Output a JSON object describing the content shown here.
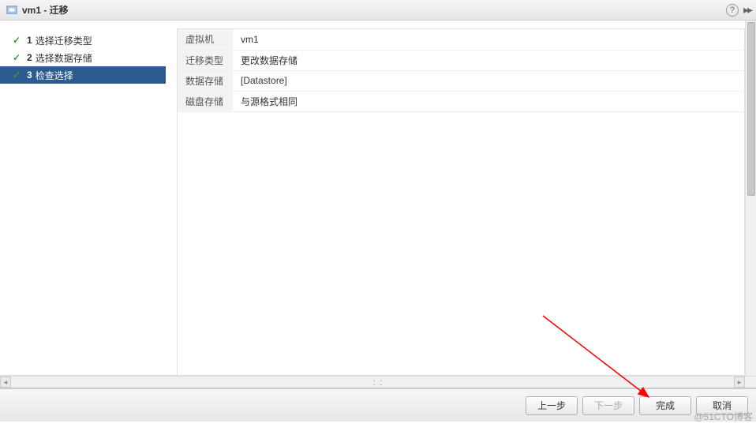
{
  "titlebar": {
    "title": "vm1 - 迁移"
  },
  "sidebar": {
    "steps": [
      {
        "num": "1",
        "label": "选择迁移类型",
        "status": "completed"
      },
      {
        "num": "2",
        "label": "选择数据存储",
        "status": "completed"
      },
      {
        "num": "3",
        "label": "检查选择",
        "status": "current"
      }
    ]
  },
  "summary": {
    "rows": [
      {
        "label": "虚拟机",
        "value": "vm1"
      },
      {
        "label": "迁移类型",
        "value": "更改数据存储"
      },
      {
        "label": "数据存储",
        "value": "[Datastore]"
      },
      {
        "label": "磁盘存储",
        "value": "与源格式相同"
      }
    ]
  },
  "footer": {
    "prev": "上一步",
    "next": "下一步",
    "finish": "完成",
    "cancel": "取消"
  },
  "watermark": "@51CTO博客"
}
